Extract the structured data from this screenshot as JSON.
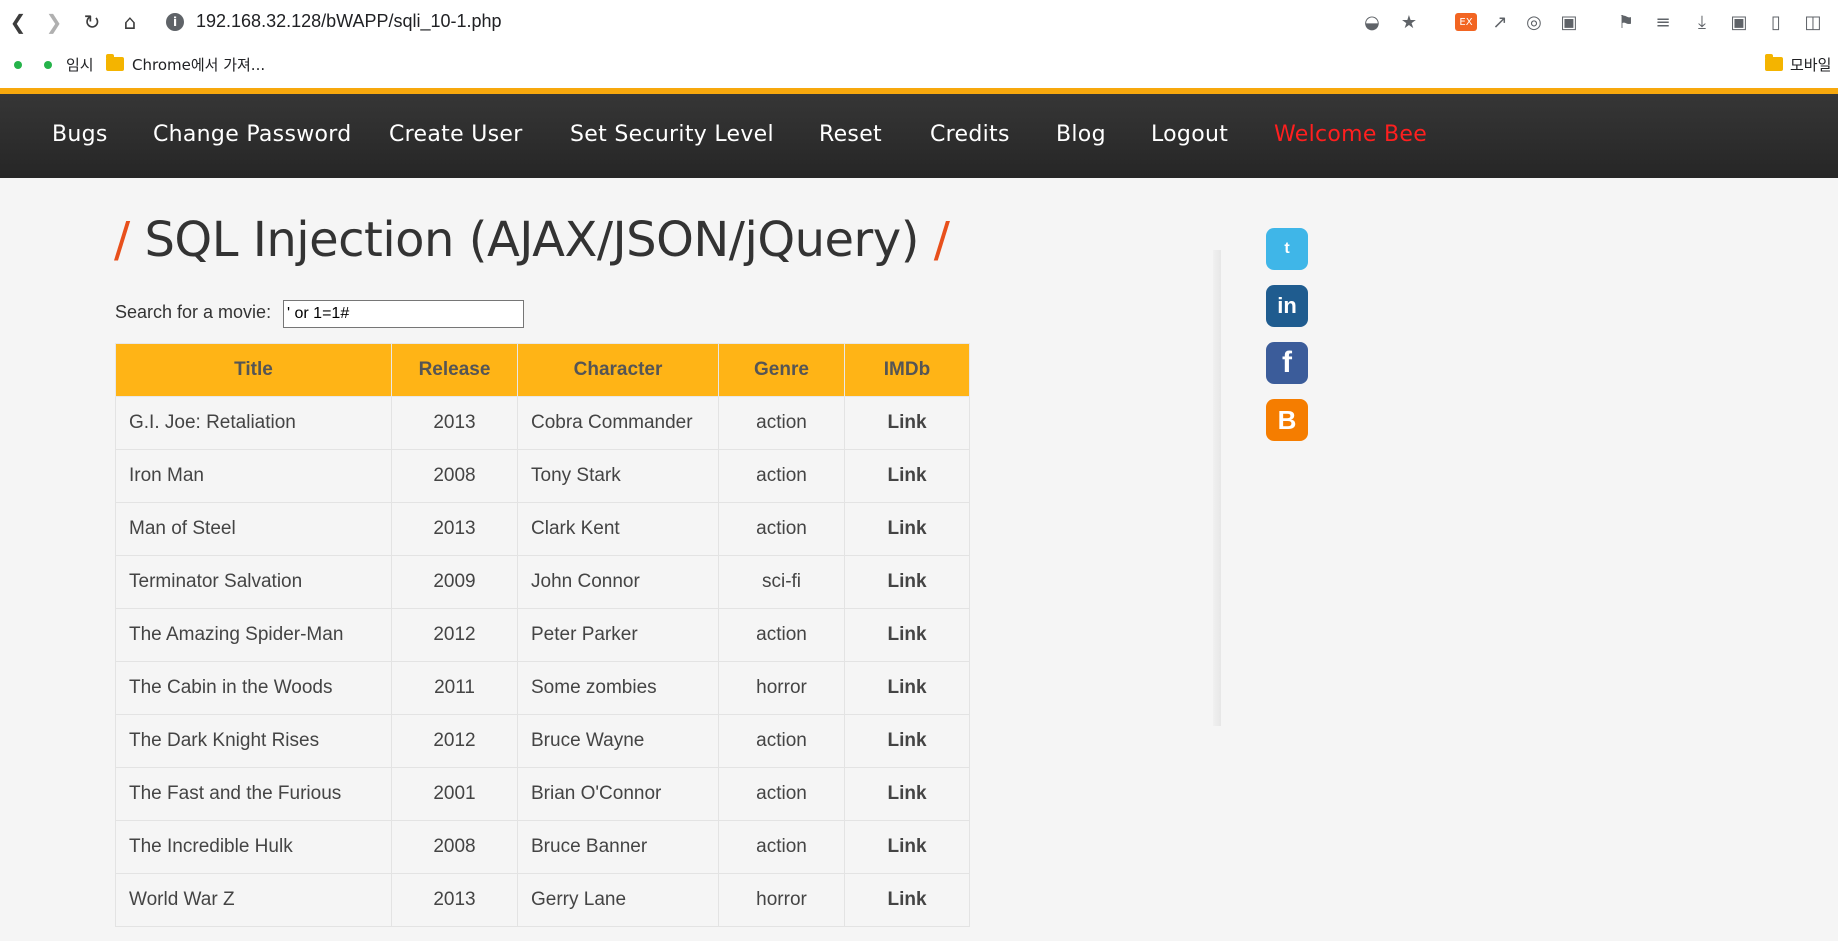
{
  "browser": {
    "url": "192.168.32.128/bWAPP/sqli_10-1.php",
    "bookmarks": [
      {
        "label": "임시"
      },
      {
        "label": "Chrome에서 가져..."
      }
    ],
    "mobile_bookmarks": "모바일"
  },
  "menu": {
    "items": [
      "Bugs",
      "Change Password",
      "Create User",
      "Set Security Level",
      "Reset",
      "Credits",
      "Blog",
      "Logout"
    ],
    "welcome": "Welcome Bee",
    "welcome_color": "#ff1f1f"
  },
  "page": {
    "title": "SQL Injection (AJAX/JSON/jQuery)",
    "slash": "/",
    "search_label": "Search for a movie:",
    "search_value": "' or 1=1#"
  },
  "table": {
    "headers": [
      "Title",
      "Release",
      "Character",
      "Genre",
      "IMDb"
    ],
    "rows": [
      [
        "G.I. Joe: Retaliation",
        "2013",
        "Cobra Commander",
        "action",
        "Link"
      ],
      [
        "Iron Man",
        "2008",
        "Tony Stark",
        "action",
        "Link"
      ],
      [
        "Man of Steel",
        "2013",
        "Clark Kent",
        "action",
        "Link"
      ],
      [
        "Terminator Salvation",
        "2009",
        "John Connor",
        "sci-fi",
        "Link"
      ],
      [
        "The Amazing Spider-Man",
        "2012",
        "Peter Parker",
        "action",
        "Link"
      ],
      [
        "The Cabin in the Woods",
        "2011",
        "Some zombies",
        "horror",
        "Link"
      ],
      [
        "The Dark Knight Rises",
        "2012",
        "Bruce Wayne",
        "action",
        "Link"
      ],
      [
        "The Fast and the Furious",
        "2001",
        "Brian O'Connor",
        "action",
        "Link"
      ],
      [
        "The Incredible Hulk",
        "2008",
        "Bruce Banner",
        "action",
        "Link"
      ],
      [
        "World War Z",
        "2013",
        "Gerry Lane",
        "horror",
        "Link"
      ]
    ]
  },
  "social": [
    {
      "icon": "twitter-icon",
      "glyph": "t",
      "color": "#3fb6e8"
    },
    {
      "icon": "linkedin-icon",
      "glyph": "in",
      "color": "#1f5c8f"
    },
    {
      "icon": "facebook-icon",
      "glyph": "f",
      "color": "#3b5c9a"
    },
    {
      "icon": "blogger-icon",
      "glyph": "B",
      "color": "#f57d00"
    }
  ],
  "colors": {
    "accent": "#ffb416",
    "header_bg": "#2f2f2f",
    "strip": "#f7a80d",
    "title_slash": "#e8501c"
  }
}
